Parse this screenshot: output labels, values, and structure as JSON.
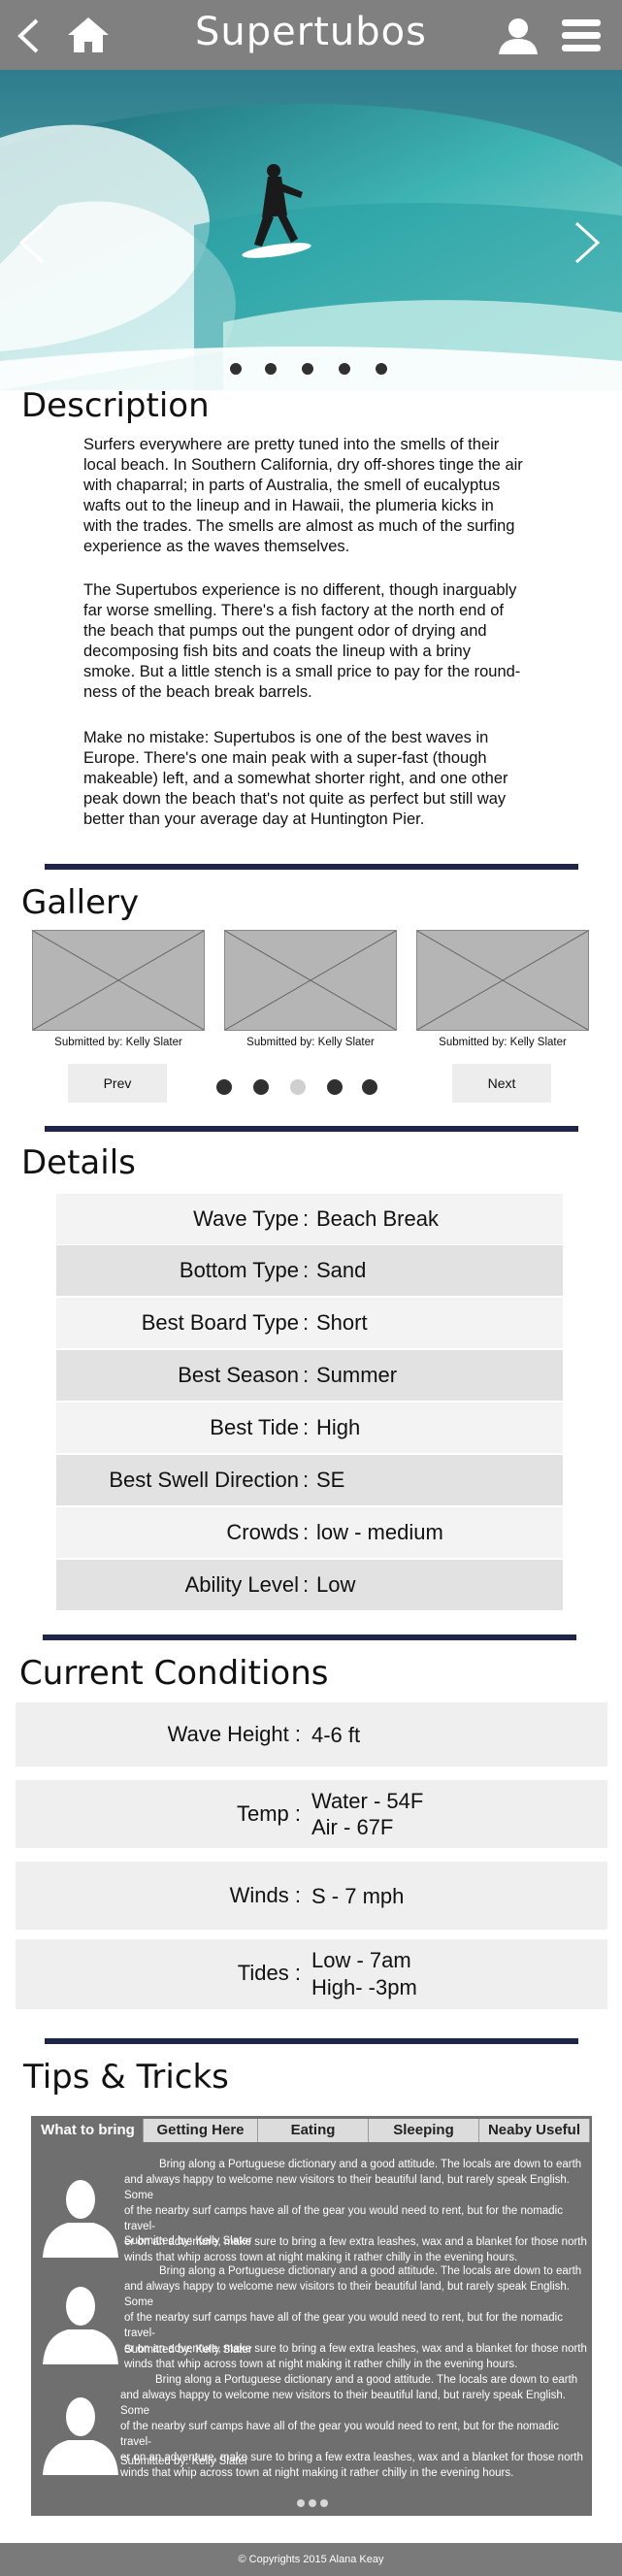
{
  "header": {
    "title": "Supertubos",
    "back_icon": "chevron-left-icon",
    "home_icon": "home-icon",
    "user_icon": "user-icon",
    "menu_icon": "hamburger-menu-icon"
  },
  "hero": {
    "prev_icon": "chevron-left-icon",
    "next_icon": "chevron-right-icon",
    "slide_count": 5
  },
  "description": {
    "heading": "Description",
    "paragraphs": [
      [
        "Surfers everywhere are pretty tuned into the smells of their",
        "local beach. In Southern California, dry off-shores tinge the air",
        "with chaparral; in parts of Australia, the smell of eucalyptus",
        "wafts out to the lineup and in Hawaii, the plumeria kicks in",
        "with the trades. The smells are almost as much of the surfing",
        "experience as the waves themselves."
      ],
      [
        "The Supertubos experience is no different, though inarguably",
        "far worse smelling. There's a fish factory at the north end of",
        "the beach that pumps out the pungent odor of drying and",
        "decomposing fish bits and coats the lineup with a briny",
        "smoke. But a little stench is a small price to pay for the round-",
        "ness of the beach break barrels."
      ],
      [
        "Make no mistake: Supertubos is one of the best waves in",
        "Europe. There's one main peak with a super-fast (though",
        "makeable) left, and a somewhat shorter right, and one other",
        "peak down the beach that's not quite as perfect but still way",
        "better than your average day at Huntington Pier."
      ]
    ]
  },
  "gallery": {
    "heading": "Gallery",
    "captions": [
      "Submitted by: Kelly Slater",
      "Submitted by: Kelly Slater",
      "Submitted by: Kelly Slater"
    ],
    "prev_label": "Prev",
    "next_label": "Next",
    "active_dot": 2
  },
  "details": {
    "heading": "Details",
    "rows": [
      {
        "label": "Wave Type",
        "value": "Beach Break"
      },
      {
        "label": "Bottom Type",
        "value": "Sand"
      },
      {
        "label": "Best Board Type",
        "value": "Short"
      },
      {
        "label": "Best Season",
        "value": "Summer"
      },
      {
        "label": "Best Tide",
        "value": "High"
      },
      {
        "label": "Best Swell Direction",
        "value": "SE"
      },
      {
        "label": "Crowds",
        "value": "low - medium"
      },
      {
        "label": "Ability Level",
        "value": "Low"
      }
    ]
  },
  "conditions": {
    "heading": "Current Conditions",
    "rows": [
      {
        "label": "Wave Height :",
        "lines": [
          "4-6 ft"
        ]
      },
      {
        "label": "Temp :",
        "lines": [
          "Water -  54F",
          "Air - 67F"
        ]
      },
      {
        "label": "Winds :",
        "lines": [
          "S - 7 mph"
        ]
      },
      {
        "label": "Tides :",
        "lines": [
          "Low - 7am",
          "High- -3pm"
        ]
      }
    ]
  },
  "tips": {
    "heading": "Tips & Tricks",
    "tabs": [
      "What to bring",
      "Getting Here",
      "Eating",
      "Sleeping",
      "Neaby Useful"
    ],
    "active_tab": 0,
    "entries": [
      {
        "lines": [
          "Bring along a Portuguese dictionary and a good attitude. The locals are down to earth",
          "and always happy to welcome new visitors to their beautiful land, but rarely speak English. Some",
          "of the nearby surf camps have all of the gear you would need to rent, but for the nomadic travel-",
          "er on an adventure, make sure to bring a few extra leashes, wax and a blanket for those north",
          "winds that whip across town at night making it rather chilly in the evening hours."
        ],
        "by": "Submitted by: Kelly Slater"
      },
      {
        "lines": [
          "Bring along a Portuguese dictionary and a good attitude. The locals are down to earth",
          "and always happy to welcome new visitors to their beautiful land, but rarely speak English. Some",
          "of the nearby surf camps have all of the gear you would need to rent, but for the nomadic travel-",
          "er on an adventure, make sure to bring a few extra leashes, wax and a blanket for those north",
          "winds that whip across town at night making it rather chilly in the evening hours."
        ],
        "by": "Submitted by: Kelly Slater"
      },
      {
        "lines": [
          "Bring along a Portuguese dictionary and a good attitude. The locals are down to earth",
          "and always happy to welcome new visitors to their beautiful land, but rarely speak English. Some",
          "of the nearby surf camps have all of the gear you would need to rent, but for the nomadic travel-",
          "er on an adventure, make sure to bring a few extra leashes, wax and a blanket for those north",
          "winds that whip across town at night making it rather chilly in the evening hours."
        ],
        "by": "Submitted by: Kelly Slater"
      }
    ]
  },
  "footer": {
    "copyright": "© Copyrights 2015 Alana Keay"
  },
  "colors": {
    "header_bg": "#808080",
    "rule": "#1f2546",
    "tips_bg": "#6f6f6f",
    "footer_bg": "#7a7a7a"
  }
}
